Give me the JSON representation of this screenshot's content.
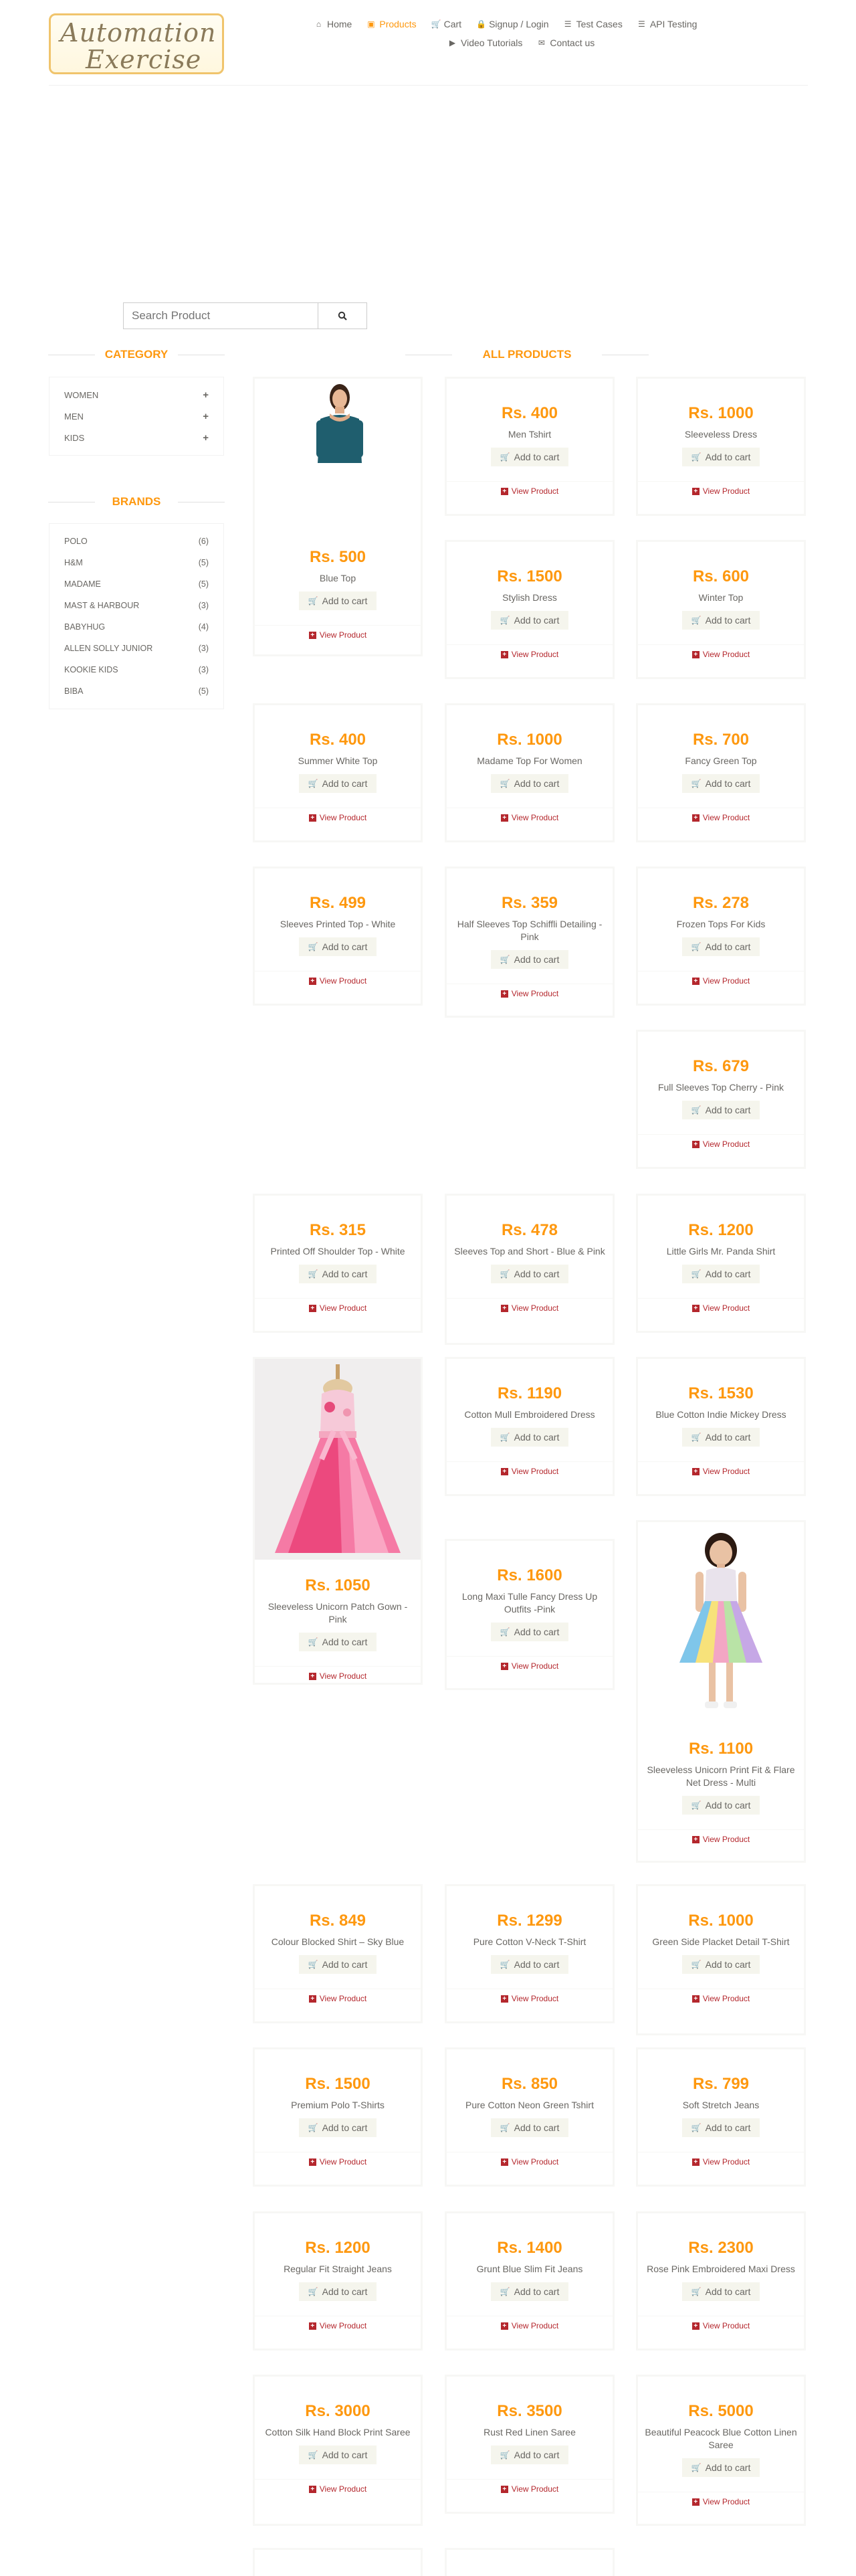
{
  "logo": {
    "line1": "Automation",
    "line2": "Exercise"
  },
  "nav": [
    [
      {
        "label": "Home",
        "icon": "home-icon",
        "glyph": "⌂",
        "active": false
      },
      {
        "label": "Products",
        "icon": "products-icon",
        "glyph": "▣",
        "active": true
      },
      {
        "label": "Cart",
        "icon": "cart-icon",
        "glyph": "🛒",
        "active": false
      },
      {
        "label": "Signup / Login",
        "icon": "lock-icon",
        "glyph": "🔒",
        "active": false
      },
      {
        "label": "Test Cases",
        "icon": "list-icon",
        "glyph": "☰",
        "active": false
      },
      {
        "label": "API Testing",
        "icon": "list-icon",
        "glyph": "☰",
        "active": false
      }
    ],
    [
      {
        "label": "Video Tutorials",
        "icon": "youtube-icon",
        "glyph": "▶",
        "active": false
      },
      {
        "label": "Contact us",
        "icon": "envelope-icon",
        "glyph": "✉",
        "active": false
      }
    ]
  ],
  "search": {
    "placeholder": "Search Product"
  },
  "category_title": "Category",
  "categories": [
    "Women",
    "Men",
    "Kids"
  ],
  "brands_title": "Brands",
  "brands": [
    {
      "name": "Polo",
      "count": "(6)"
    },
    {
      "name": "H&M",
      "count": "(5)"
    },
    {
      "name": "Madame",
      "count": "(5)"
    },
    {
      "name": "Mast & Harbour",
      "count": "(3)"
    },
    {
      "name": "Babyhug",
      "count": "(4)"
    },
    {
      "name": "Allen Solly Junior",
      "count": "(3)"
    },
    {
      "name": "Kookie Kids",
      "count": "(3)"
    },
    {
      "name": "Biba",
      "count": "(5)"
    }
  ],
  "products_title": "All Products",
  "add_to_cart_label": "Add to cart",
  "view_product_label": "View Product",
  "products": [
    {
      "price": "Rs. 500",
      "name": "Blue Top",
      "image": "woman-blue-top"
    },
    {
      "price": "Rs. 400",
      "name": "Men Tshirt"
    },
    {
      "price": "Rs. 1000",
      "name": "Sleeveless Dress"
    },
    {
      "price": "Rs. 1500",
      "name": "Stylish Dress"
    },
    {
      "price": "Rs. 600",
      "name": "Winter Top"
    },
    {
      "price": "Rs. 400",
      "name": "Summer White Top"
    },
    {
      "price": "Rs. 1000",
      "name": "Madame Top For Women"
    },
    {
      "price": "Rs. 700",
      "name": "Fancy Green Top"
    },
    {
      "price": "Rs. 499",
      "name": "Sleeves Printed Top - White"
    },
    {
      "price": "Rs. 359",
      "name": "Half Sleeves Top Schiffli Detailing - Pink"
    },
    {
      "price": "Rs. 278",
      "name": "Frozen Tops For Kids"
    },
    {
      "price": "Rs. 679",
      "name": "Full Sleeves Top Cherry - Pink"
    },
    {
      "price": "Rs. 315",
      "name": "Printed Off Shoulder Top - White"
    },
    {
      "price": "Rs. 478",
      "name": "Sleeves Top and Short - Blue & Pink"
    },
    {
      "price": "Rs. 1200",
      "name": "Little Girls Mr. Panda Shirt"
    },
    {
      "price": "Rs. 1050",
      "name": "Sleeveless Unicorn Patch Gown - Pink",
      "image": "pink-gown"
    },
    {
      "price": "Rs. 1190",
      "name": "Cotton Mull Embroidered Dress"
    },
    {
      "price": "Rs. 1530",
      "name": "Blue Cotton Indie Mickey Dress"
    },
    {
      "price": "Rs. 1600",
      "name": "Long Maxi Tulle Fancy Dress Up Outfits -Pink"
    },
    {
      "price": "Rs. 1100",
      "name": "Sleeveless Unicorn Print Fit & Flare Net Dress - Multi",
      "image": "girl-rainbow-dress"
    },
    {
      "price": "Rs. 849",
      "name": "Colour Blocked Shirt – Sky Blue"
    },
    {
      "price": "Rs. 1299",
      "name": "Pure Cotton V-Neck T-Shirt"
    },
    {
      "price": "Rs. 1000",
      "name": "Green Side Placket Detail T-Shirt"
    },
    {
      "price": "Rs. 1500",
      "name": "Premium Polo T-Shirts"
    },
    {
      "price": "Rs. 850",
      "name": "Pure Cotton Neon Green Tshirt"
    },
    {
      "price": "Rs. 799",
      "name": "Soft Stretch Jeans"
    },
    {
      "price": "Rs. 1200",
      "name": "Regular Fit Straight Jeans"
    },
    {
      "price": "Rs. 1400",
      "name": "Grunt Blue Slim Fit Jeans"
    },
    {
      "price": "Rs. 2300",
      "name": "Rose Pink Embroidered Maxi Dress"
    },
    {
      "price": "Rs. 3000",
      "name": "Cotton Silk Hand Block Print Saree"
    },
    {
      "price": "Rs. 3500",
      "name": "Rust Red Linen Saree"
    },
    {
      "price": "Rs. 5000",
      "name": "Beautiful Peacock Blue Cotton Linen Saree"
    },
    {
      "price": "",
      "name": ""
    },
    {
      "price": "",
      "name": ""
    }
  ]
}
